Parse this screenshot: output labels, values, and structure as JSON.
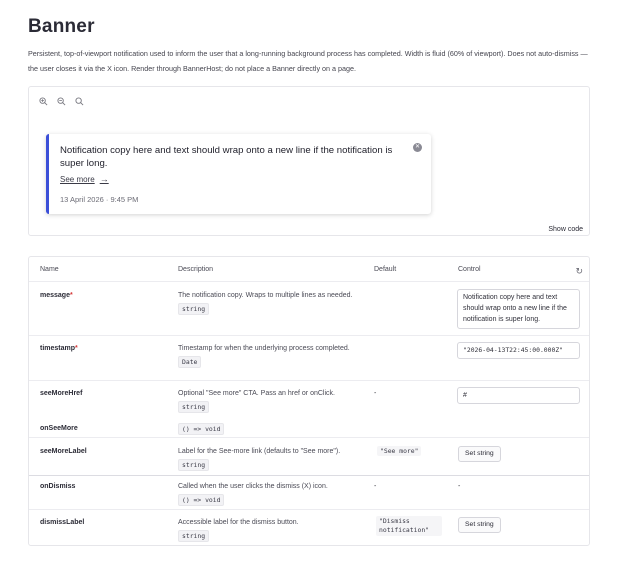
{
  "page": {
    "title": "Banner",
    "description": "Persistent, top-of-viewport notification used to inform the user that a long-running background process has completed. Width is fluid (60% of viewport). Does not auto-dismiss — the user closes it via the X icon. Render through BannerHost; do not place a Banner directly on a page."
  },
  "toolbar": {
    "icons": [
      "zoom-in-icon",
      "zoom-out-icon",
      "zoom-reset-icon"
    ]
  },
  "banner": {
    "message": "Notification copy here and text should wrap onto a new line if the notification is super long.",
    "see_more_label": "See more",
    "arrow": "→",
    "timestamp": "13 April 2026 · 9:45 PM",
    "close_glyph": "✕",
    "accent_color": "#3b4fd8"
  },
  "show_code_label": "Show code",
  "table": {
    "headers": {
      "name": "Name",
      "description": "Description",
      "default": "Default",
      "control": "Control"
    },
    "reset_glyph": "↻",
    "rows": [
      {
        "name": "message",
        "required": "*",
        "description": "The notification copy. Wraps to multiple lines as needed.",
        "type": "string",
        "default": "",
        "control_value": "Notification copy here and text should wrap onto a new line if the notification is super long."
      },
      {
        "name": "timestamp",
        "required": "*",
        "description": "Timestamp for when the underlying process completed.",
        "type": "Date",
        "default": "",
        "control_value": "\"2026-04-13T22:45:00.000Z\""
      },
      {
        "name": "seeMoreHref",
        "required": "",
        "description": "Optional \"See more\" CTA. Pass an href or onClick.",
        "type": "string",
        "default": "-",
        "control_value": "#"
      },
      {
        "name": "onSeeMore",
        "required": "",
        "description": "",
        "type": "() => void",
        "default": "",
        "control_value": ""
      },
      {
        "name": "seeMoreLabel",
        "required": "",
        "description": "Label for the See-more link (defaults to \"See more\").",
        "type": "string",
        "default": "\"See more\"",
        "control_value": "Set string"
      },
      {
        "name": "onDismiss",
        "required": "",
        "description": "Called when the user clicks the dismiss (X) icon.",
        "type": "() => void",
        "default": "-",
        "control_value": "-"
      },
      {
        "name": "dismissLabel",
        "required": "",
        "description": "Accessible label for the dismiss button.",
        "type": "string",
        "default": "\"Dismiss notification\"",
        "control_value": "Set string"
      }
    ]
  }
}
